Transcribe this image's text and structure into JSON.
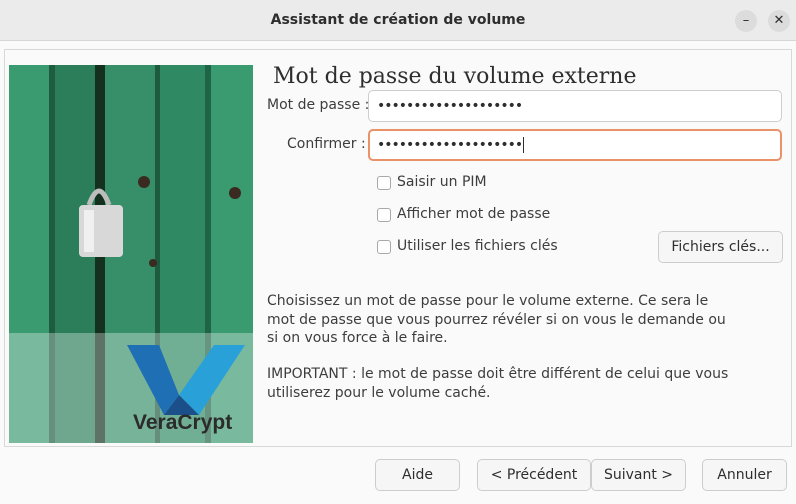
{
  "window": {
    "title": "Assistant de création de volume"
  },
  "heading": "Mot de passe du volume externe",
  "password": {
    "label": "Mot de passe :",
    "value": "••••••••••••••••••••"
  },
  "confirm": {
    "label": "Confirmer :",
    "value": "••••••••••••••••••••"
  },
  "options": {
    "pim": "Saisir un PIM",
    "show_password": "Afficher mot de passe",
    "keyfiles": "Utiliser les fichiers clés",
    "keyfiles_button": "Fichiers clés..."
  },
  "info": {
    "p1": "Choisissez un mot de passe pour le volume externe. Ce sera le mot de passe que vous pourrez révéler si on vous le demande ou si on vous force à le faire.",
    "p2": "IMPORTANT : le mot de passe doit être différent de celui que vous utiliserez pour le volume caché."
  },
  "logo": {
    "text": "VeraCrypt"
  },
  "buttons": {
    "help": "Aide",
    "prev": "< Précédent",
    "next": "Suivant >",
    "cancel": "Annuler"
  },
  "colors": {
    "focus_border": "#e9926a",
    "door_green": "#2f8a63",
    "logo_blue": "#1f6fb5"
  }
}
